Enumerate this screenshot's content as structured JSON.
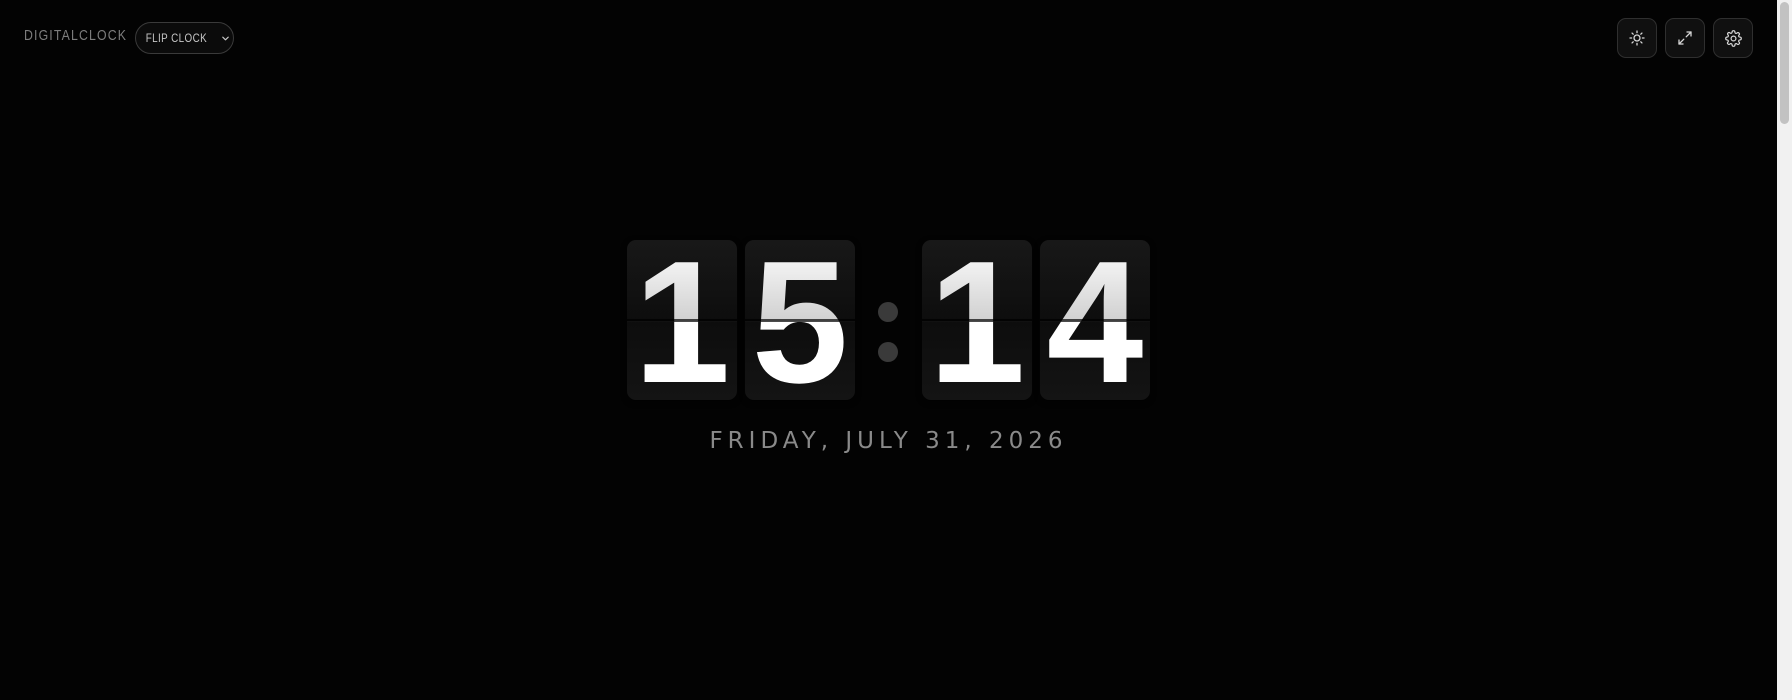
{
  "header": {
    "logo": "DIGITALCLOCK",
    "mode_select": {
      "selected": "FLIP CLOCK"
    },
    "tools": [
      {
        "name": "theme-toggle",
        "icon": "sun-icon"
      },
      {
        "name": "fullscreen",
        "icon": "expand-icon"
      },
      {
        "name": "settings",
        "icon": "gear-icon"
      }
    ]
  },
  "clock": {
    "hours": [
      "1",
      "5"
    ],
    "minutes": [
      "1",
      "4"
    ],
    "separator": "colon-dots"
  },
  "date": "FRIDAY, JULY 31, 2026",
  "colors": {
    "background": "#030303",
    "card": "#141414",
    "digit": "#ffffff",
    "date_text": "#8a8a8a",
    "colon": "#3a3a3a"
  }
}
